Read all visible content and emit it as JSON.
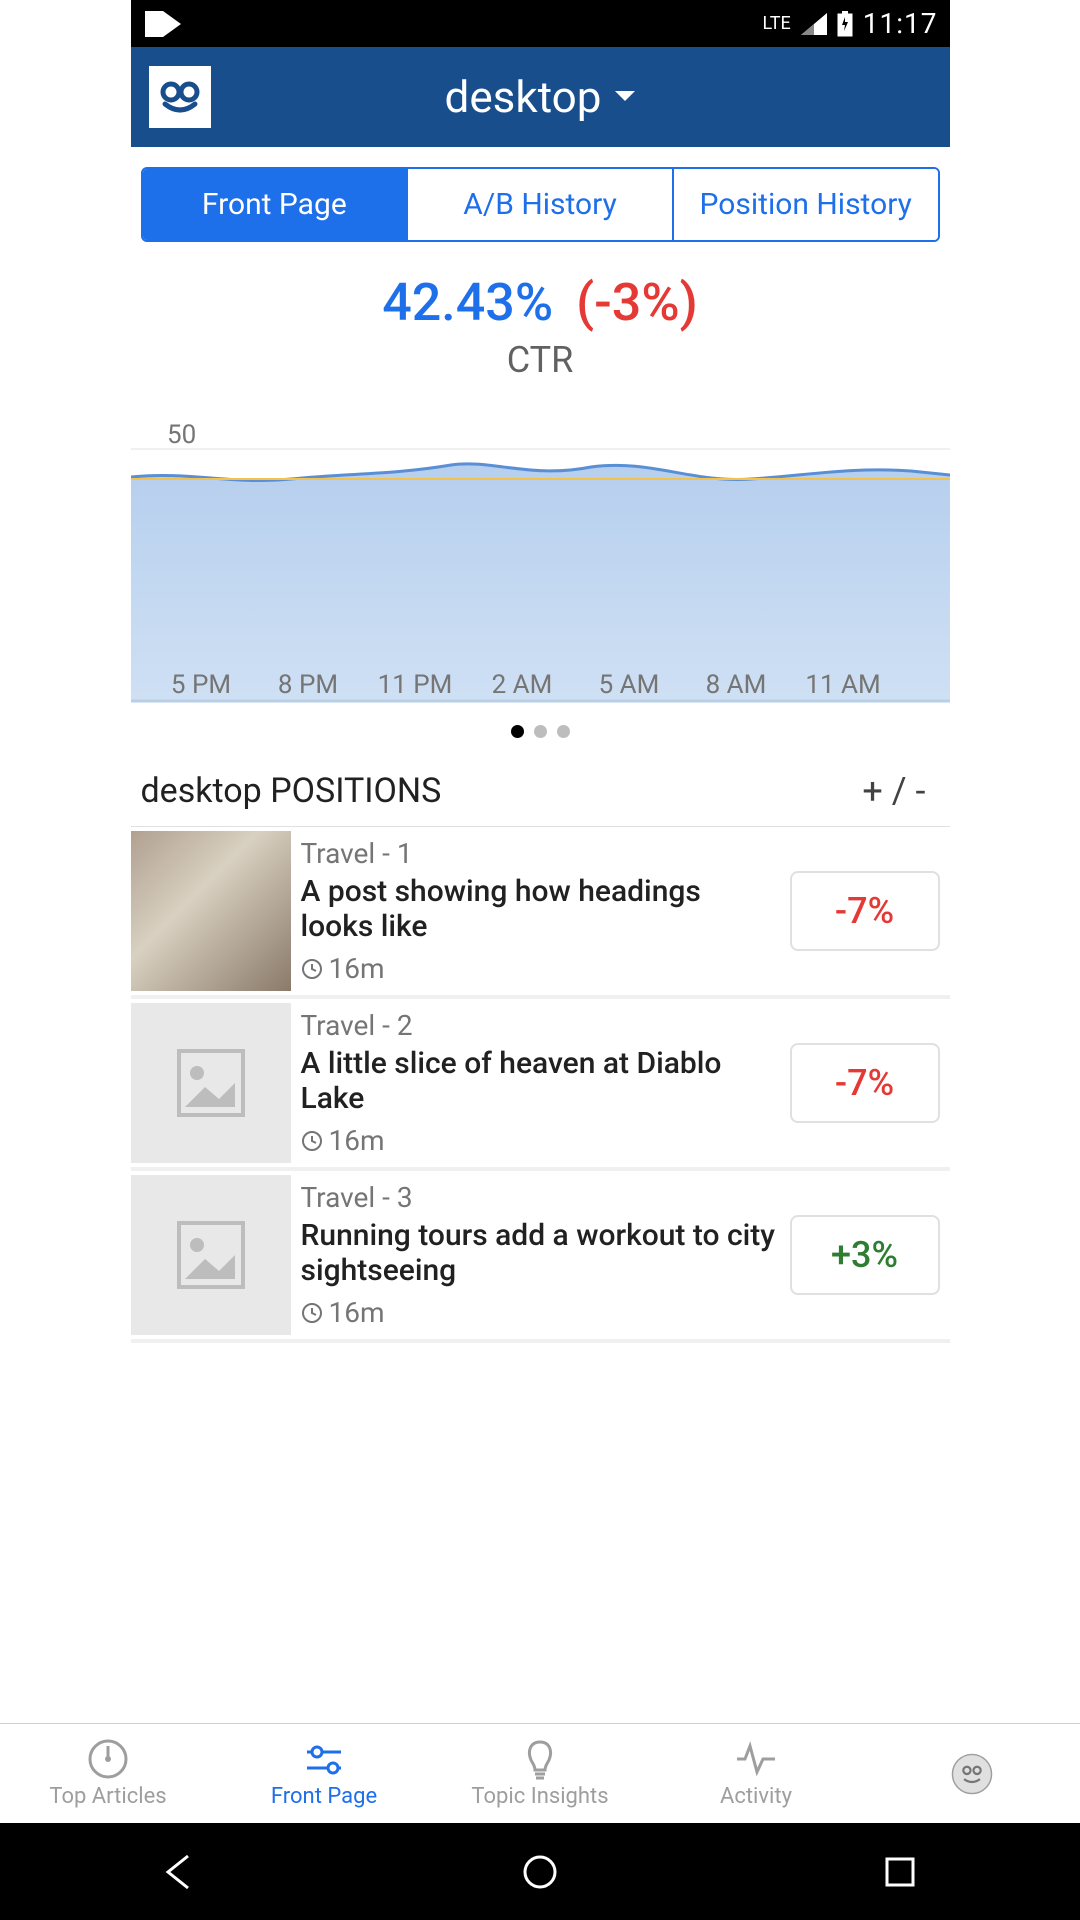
{
  "status": {
    "lte": "LTE",
    "time": "11:17"
  },
  "header": {
    "title": "desktop"
  },
  "tabs": [
    {
      "label": "Front Page"
    },
    {
      "label": "A/B History"
    },
    {
      "label": "Position History"
    }
  ],
  "metric": {
    "value": "42.43%",
    "change": "(-3%)",
    "label": "CTR"
  },
  "chart_data": {
    "type": "line",
    "title": "CTR",
    "ylabel": "",
    "xlabel": "",
    "ylim": [
      0,
      55
    ],
    "y_ticks": [
      10,
      20,
      30,
      40,
      50
    ],
    "categories": [
      "5 PM",
      "8 PM",
      "11 PM",
      "2 AM",
      "5 AM",
      "8 AM",
      "11 AM"
    ],
    "series": [
      {
        "name": "CTR",
        "values": [
          42,
          43,
          42,
          43,
          44,
          41,
          42,
          44,
          42,
          42,
          42,
          43,
          42,
          42
        ]
      },
      {
        "name": "Baseline",
        "values": [
          42,
          42,
          42,
          42,
          42,
          42,
          42,
          42,
          42,
          42,
          42,
          42,
          42,
          42
        ]
      }
    ]
  },
  "page_indicator": {
    "count": 3,
    "active": 0
  },
  "positions": {
    "title": "desktop POSITIONS",
    "toggle": "+ / -",
    "rows": [
      {
        "category": "Travel - 1",
        "title": "A post showing how headings looks like",
        "time": "16m",
        "change": "-7%",
        "dir": "neg",
        "has_img": true
      },
      {
        "category": "Travel - 2",
        "title": "A little slice of heaven at Diablo Lake",
        "time": "16m",
        "change": "-7%",
        "dir": "neg",
        "has_img": false
      },
      {
        "category": "Travel - 3",
        "title": "Running tours add a workout to city sightseeing",
        "time": "16m",
        "change": "+3%",
        "dir": "pos",
        "has_img": false
      }
    ]
  },
  "bottom_nav": [
    {
      "label": "Top Articles"
    },
    {
      "label": "Front Page"
    },
    {
      "label": "Topic Insights"
    },
    {
      "label": "Activity"
    },
    {
      "label": ""
    }
  ]
}
